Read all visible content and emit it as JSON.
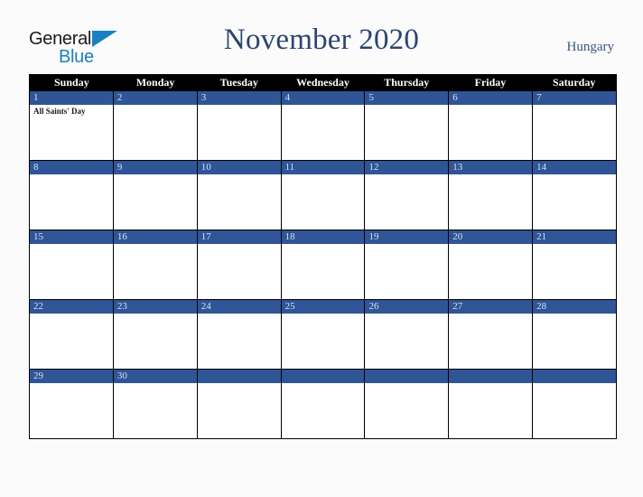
{
  "brand": {
    "name_part1": "General",
    "name_part2": "Blue",
    "triangle_color": "#1b7fc4"
  },
  "header": {
    "title": "November 2020",
    "country": "Hungary",
    "title_color": "#2b4570"
  },
  "calendar": {
    "weekdays": [
      "Sunday",
      "Monday",
      "Tuesday",
      "Wednesday",
      "Thursday",
      "Friday",
      "Saturday"
    ],
    "accent_color": "#2f5597",
    "header_bg": "#000000",
    "weeks": [
      [
        {
          "day": "1",
          "events": [
            "All Saints' Day"
          ]
        },
        {
          "day": "2",
          "events": []
        },
        {
          "day": "3",
          "events": []
        },
        {
          "day": "4",
          "events": []
        },
        {
          "day": "5",
          "events": []
        },
        {
          "day": "6",
          "events": []
        },
        {
          "day": "7",
          "events": []
        }
      ],
      [
        {
          "day": "8",
          "events": []
        },
        {
          "day": "9",
          "events": []
        },
        {
          "day": "10",
          "events": []
        },
        {
          "day": "11",
          "events": []
        },
        {
          "day": "12",
          "events": []
        },
        {
          "day": "13",
          "events": []
        },
        {
          "day": "14",
          "events": []
        }
      ],
      [
        {
          "day": "15",
          "events": []
        },
        {
          "day": "16",
          "events": []
        },
        {
          "day": "17",
          "events": []
        },
        {
          "day": "18",
          "events": []
        },
        {
          "day": "19",
          "events": []
        },
        {
          "day": "20",
          "events": []
        },
        {
          "day": "21",
          "events": []
        }
      ],
      [
        {
          "day": "22",
          "events": []
        },
        {
          "day": "23",
          "events": []
        },
        {
          "day": "24",
          "events": []
        },
        {
          "day": "25",
          "events": []
        },
        {
          "day": "26",
          "events": []
        },
        {
          "day": "27",
          "events": []
        },
        {
          "day": "28",
          "events": []
        }
      ],
      [
        {
          "day": "29",
          "events": []
        },
        {
          "day": "30",
          "events": []
        },
        {
          "day": "",
          "events": []
        },
        {
          "day": "",
          "events": []
        },
        {
          "day": "",
          "events": []
        },
        {
          "day": "",
          "events": []
        },
        {
          "day": "",
          "events": []
        }
      ]
    ]
  }
}
